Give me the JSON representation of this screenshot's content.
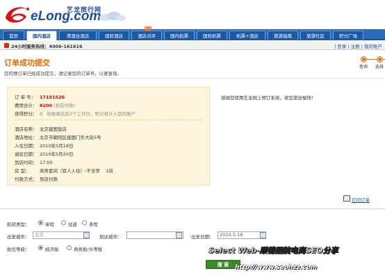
{
  "header": {
    "logo_cn": "艺龙旅行网",
    "logo_en": "eLong.com"
  },
  "nav": {
    "tabs": [
      {
        "label": "首页",
        "active": false
      },
      {
        "label": "国内酒店",
        "active": true
      },
      {
        "label": "港澳台酒店",
        "active": false
      },
      {
        "label": "国际酒店",
        "active": false
      },
      {
        "label": "酒店点评",
        "active": false
      },
      {
        "label": "国内机票",
        "active": false
      },
      {
        "label": "国际机票",
        "active": false
      },
      {
        "label": "机票+酒店",
        "active": false
      },
      {
        "label": "旅游指南",
        "active": false
      },
      {
        "label": "旅游社区",
        "active": false
      },
      {
        "label": "积分广场",
        "active": false
      }
    ]
  },
  "hotbar": {
    "text": "24小时服务热线：4006-161616",
    "links": "| 登录 | 注册 | 我的账户"
  },
  "page": {
    "title": "订单成功提交",
    "subtitle": "您的预订单已经成功提交，请记录您的订单号，以便查询。",
    "steps": [
      "查询",
      "选择"
    ]
  },
  "order": {
    "number_label": "订 单 号：",
    "number": "17151526",
    "fee_label": "费用合计：",
    "fee": "¥200",
    "fee_note": "(到店付款)",
    "points_label": "获得积分：",
    "points": "0",
    "points_note": "结帐离店后3个工作日，积分将计入您的账户",
    "hotel_name_label": "酒店名称：",
    "hotel_name": "北京建国饭店",
    "hotel_addr_label": "酒店地址：",
    "hotel_addr": "北京市朝阳区建国门外大街5号",
    "checkin_label": "入住日期：",
    "checkin": "2010年5月18日",
    "checkout_label": "退房日期：",
    "checkout": "2010年5月20日",
    "arrive_label": "到店时间：",
    "arrive": "17:00",
    "room_label": "房    型：",
    "room": "商务套间（双人入住）-不含早",
    "room_count": "1间",
    "pay_label": "付款方式：",
    "pay": "到店付款"
  },
  "thanks": "感谢您使用艺龙网上预订系统，祝您旅途愉快!",
  "print_label": "打印订单",
  "search": {
    "trip_type_label": "航班类型：",
    "trip_types": [
      "单程",
      "往返",
      "多程"
    ],
    "from_label": "出发城市：",
    "from_value": "北京",
    "to_label": "到达城市：",
    "to_value": "",
    "date_label": "出发日期：",
    "date_value": "2010-5-18",
    "cabin_label": "舱位等级：",
    "cabins": [
      "经济舱",
      "商务舱/头等舱"
    ],
    "button": "搜  索"
  },
  "watermark": {
    "line1": "Select Web-顺德朋院电商SEO分享",
    "line2": "http://www.seohzz.com"
  }
}
